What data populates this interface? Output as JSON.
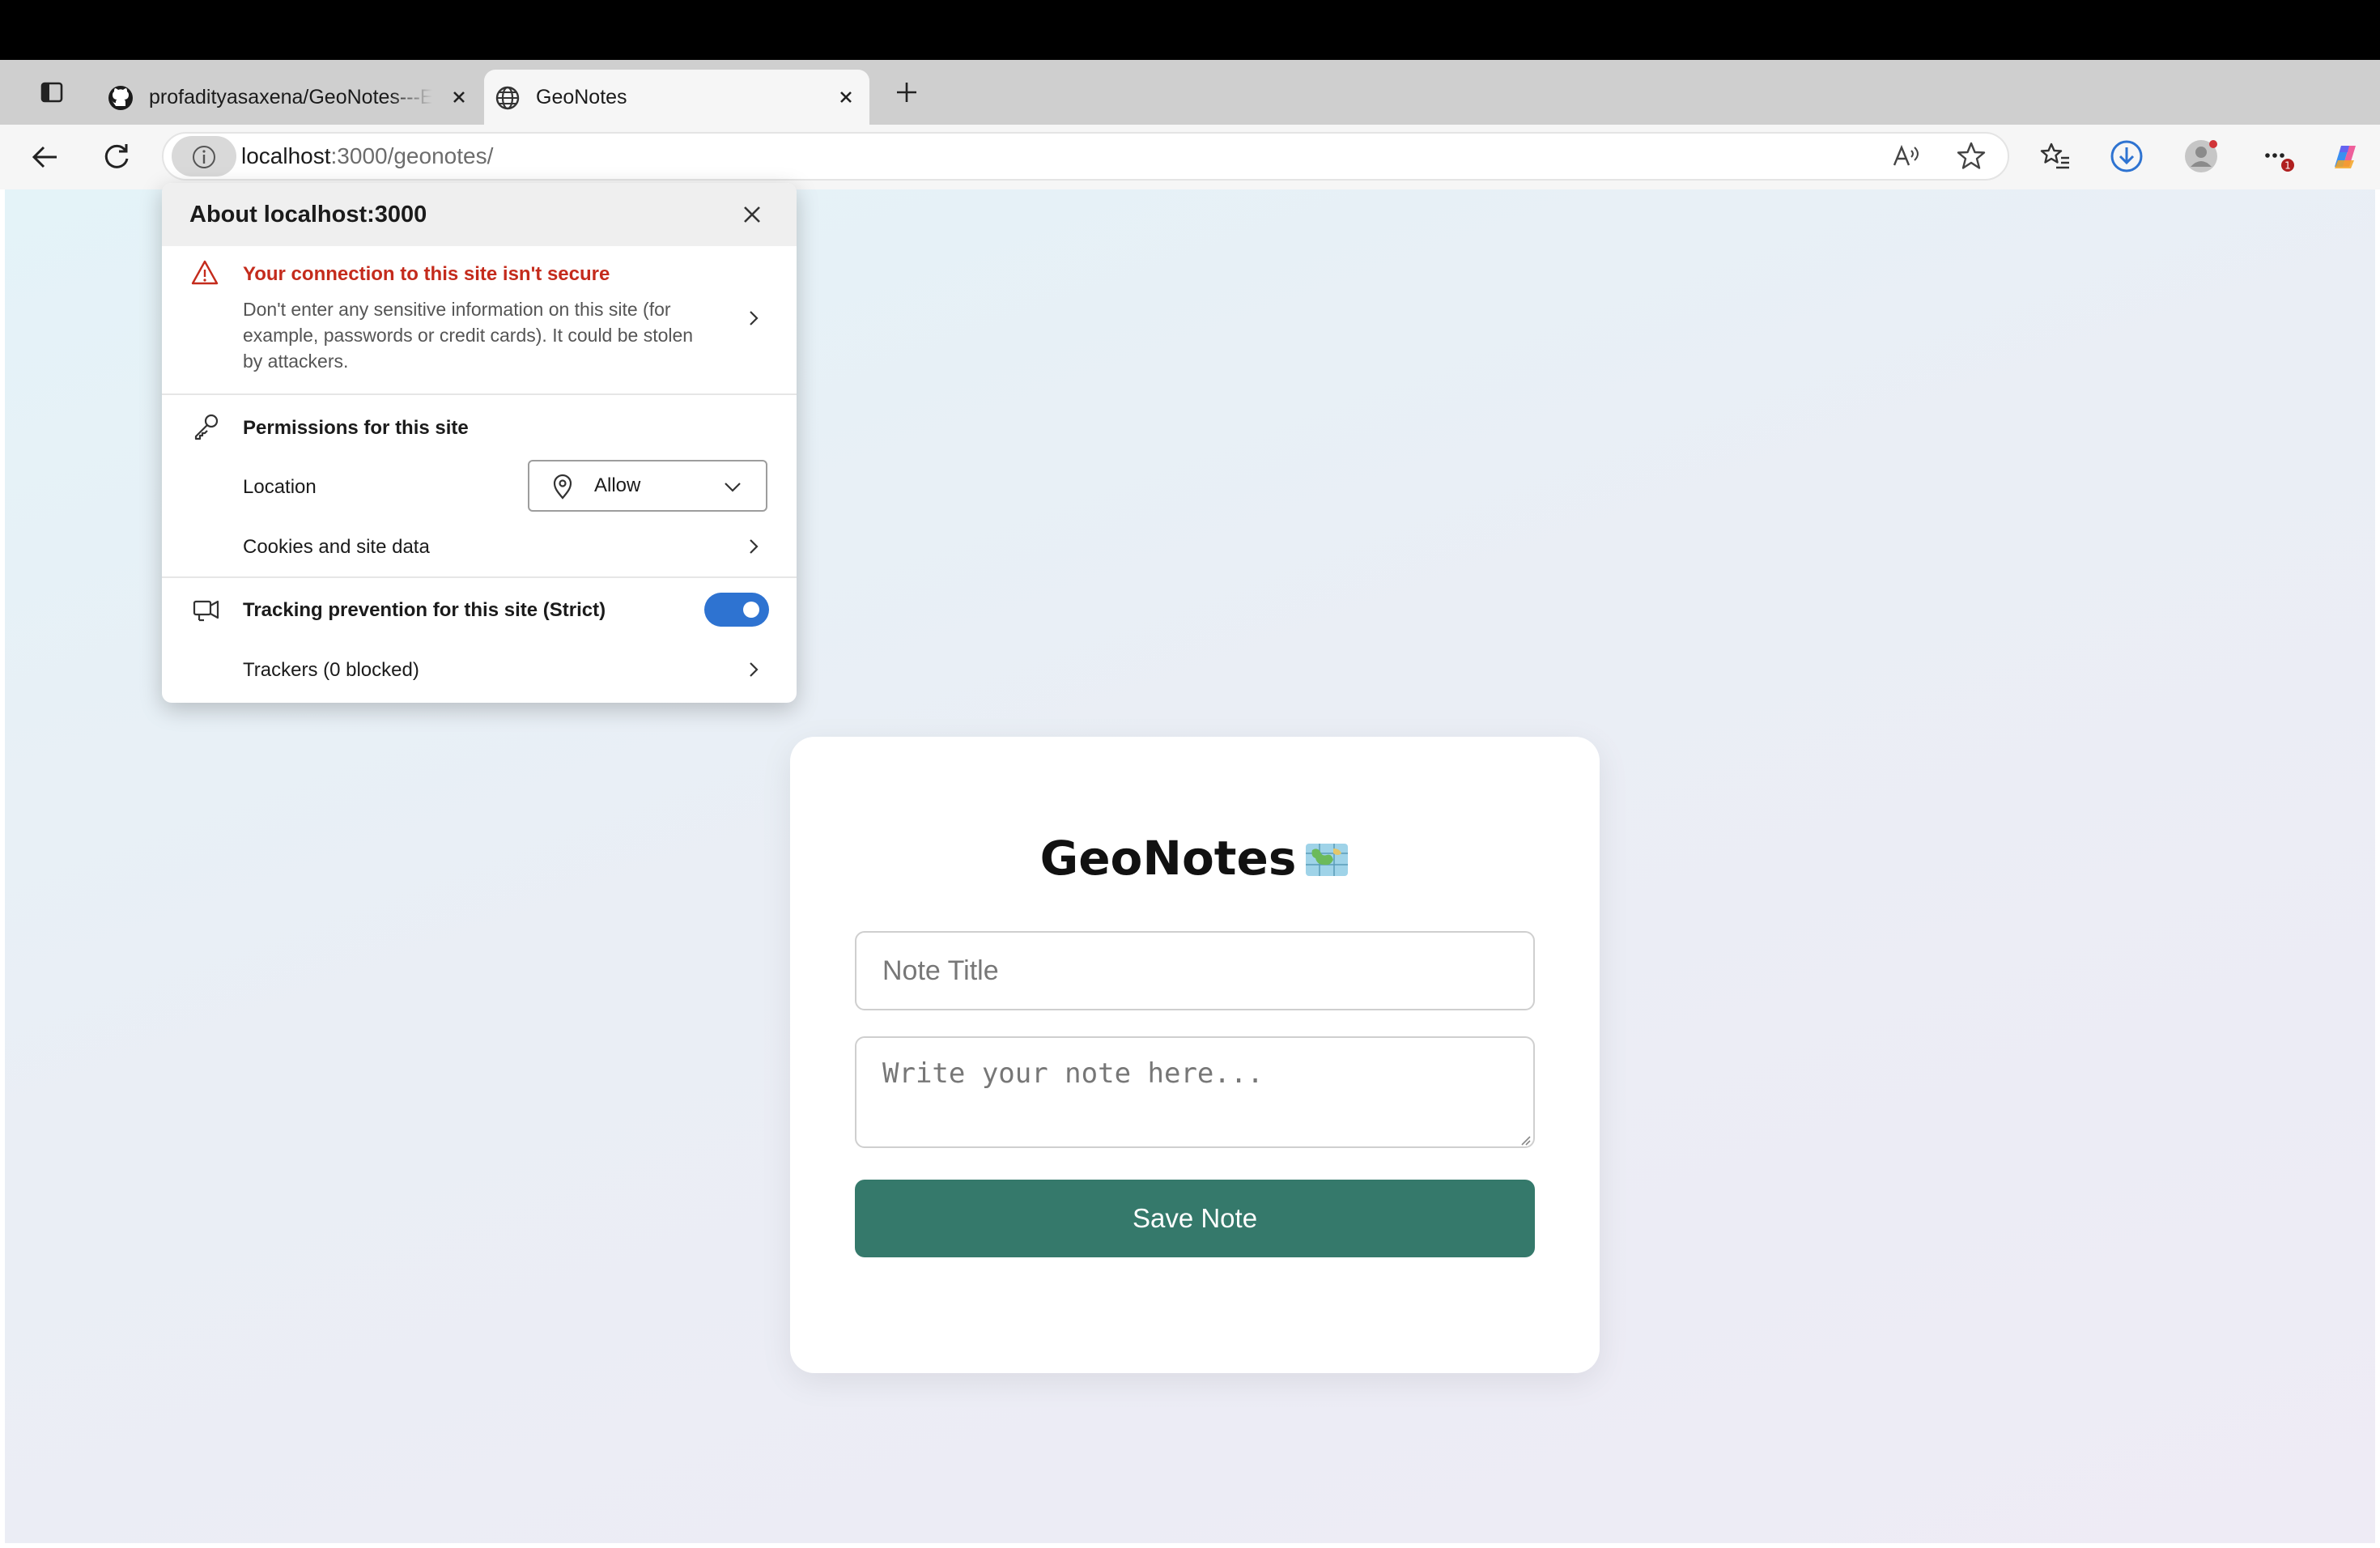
{
  "browser": {
    "tabs": [
      {
        "title": "profadityasaxena/GeoNotes---Exploring-Geolocation-API"
      },
      {
        "title": "GeoNotes"
      }
    ],
    "address": {
      "host": "localhost",
      "path": ":3000/geonotes/"
    },
    "accent": "#2e73d1"
  },
  "popup": {
    "title": "About localhost:3000",
    "warning_title": "Your connection to this site isn't secure",
    "warning_desc": "Don't enter any sensitive information on this site (for example, passwords or credit cards). It could be stolen by attackers.",
    "permissions_heading": "Permissions for this site",
    "location_label": "Location",
    "location_value": "Allow",
    "cookies_label": "Cookies and site data",
    "tracking_label": "Tracking prevention for this site (Strict)",
    "tracking_enabled": true,
    "trackers_label": "Trackers (0 blocked)",
    "warning_color": "#c42b1c"
  },
  "app": {
    "title": "GeoNotes",
    "title_icon": "map-emoji",
    "title_placeholder": "Note Title",
    "note_placeholder": "Write your note here...",
    "save_label": "Save Note",
    "button_color": "#35796b"
  }
}
